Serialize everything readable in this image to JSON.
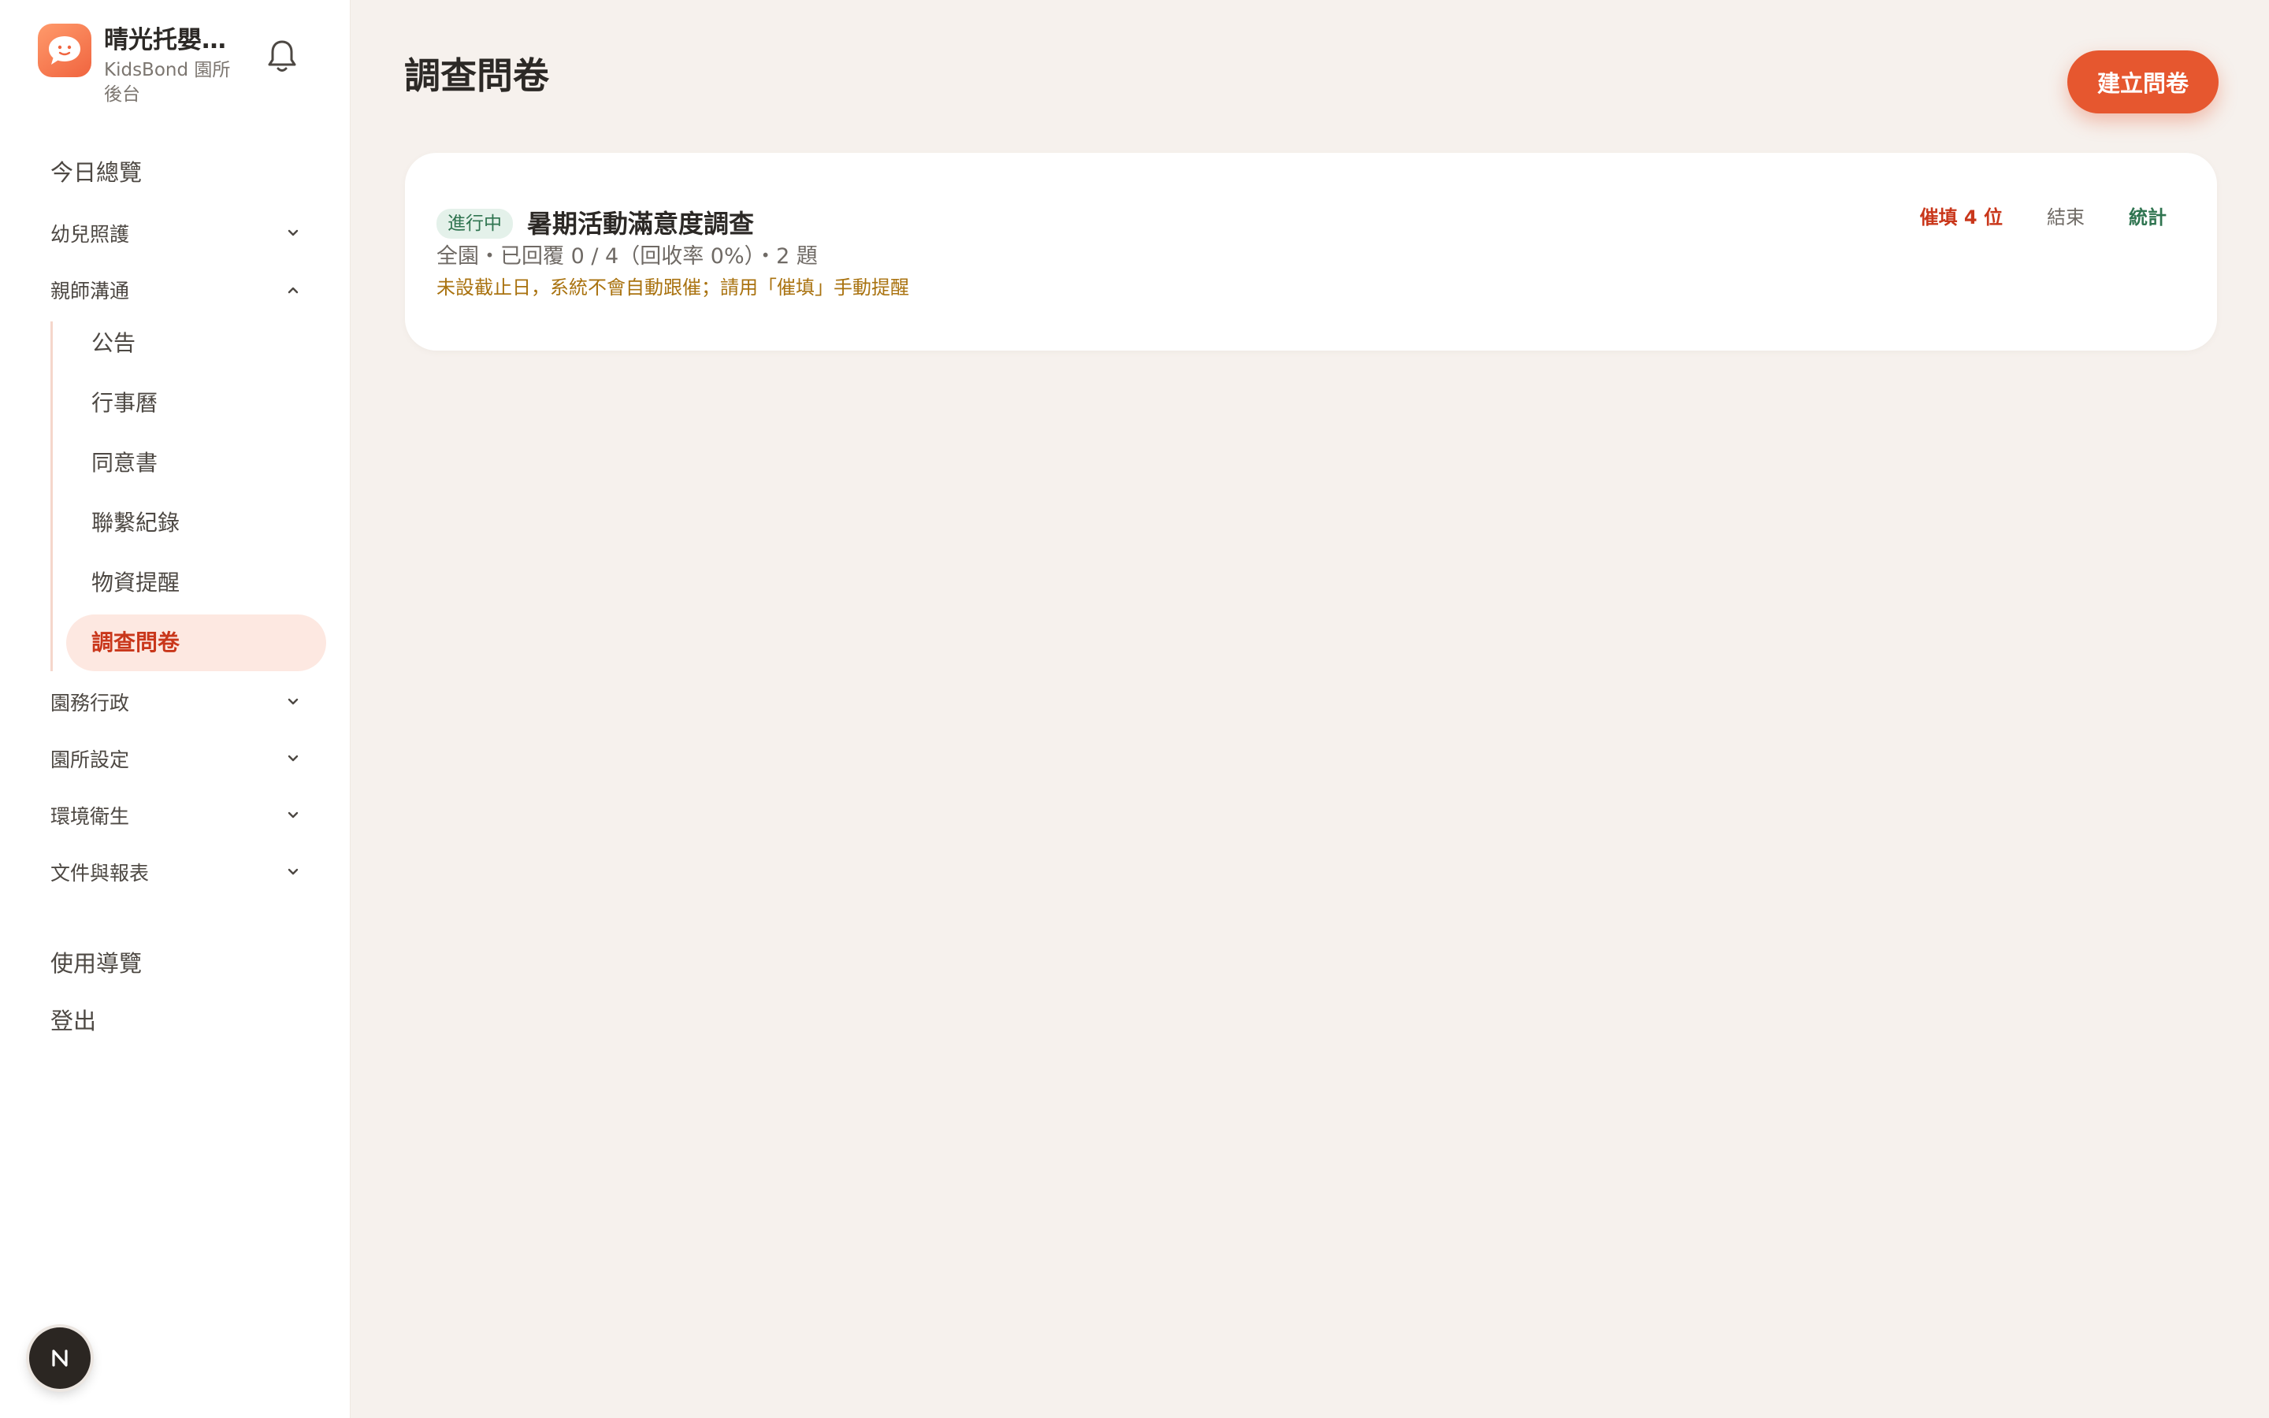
{
  "brand": {
    "name": "晴光托嬰中心",
    "sub": "KidsBond 園所後台"
  },
  "nav": {
    "today": "今日總覽",
    "groups": {
      "infant_care": "幼兒照護",
      "parent_comm": "親師溝通",
      "admin": "園務行政",
      "settings": "園所設定",
      "hygiene": "環境衛生",
      "docs": "文件與報表"
    },
    "sub_items": [
      "公告",
      "行事曆",
      "同意書",
      "聯繫紀錄",
      "物資提醒",
      "調查問卷"
    ],
    "guide": "使用導覽",
    "logout": "登出"
  },
  "page": {
    "title": "調查問卷",
    "create_label": "建立問卷"
  },
  "survey": {
    "status": "進行中",
    "title": "暑期活動滿意度調查",
    "meta": "全園・已回覆 0 / 4（回收率 0%）・2 題",
    "note": "未設截止日，系統不會自動跟催；請用「催填」手動提醒",
    "actions": {
      "remind": "催填 4 位",
      "end": "結束",
      "stats": "統計"
    }
  },
  "badge": {
    "letter": "N"
  },
  "colors": {
    "accent": "#e6572f",
    "active_text": "#c9371b",
    "active_bg": "#fde8e1",
    "status_green": "#2f7450",
    "note_amber": "#a9720f",
    "page_bg": "#f6f1ed"
  }
}
